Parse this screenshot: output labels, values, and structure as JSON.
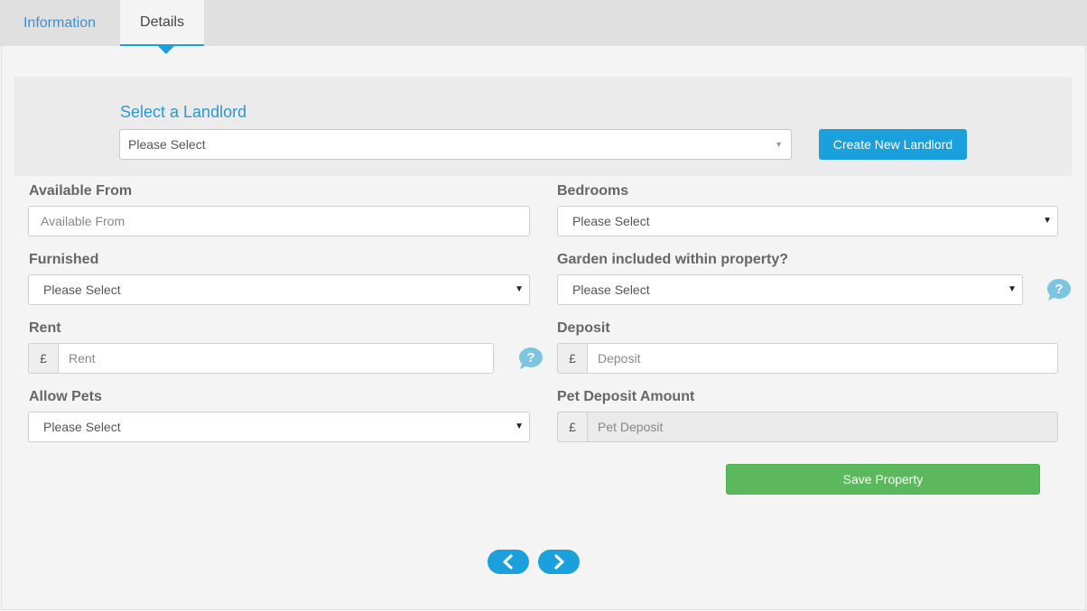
{
  "tabs": [
    {
      "label": "Information",
      "active": false
    },
    {
      "label": "Details",
      "active": true
    }
  ],
  "landlord": {
    "title": "Select a Landlord",
    "select_value": "Please Select",
    "create_button": "Create New Landlord"
  },
  "form": {
    "available_from": {
      "label": "Available From",
      "placeholder": "Available From"
    },
    "bedrooms": {
      "label": "Bedrooms",
      "value": "Please Select"
    },
    "furnished": {
      "label": "Furnished",
      "value": "Please Select"
    },
    "garden": {
      "label": "Garden included within property?",
      "value": "Please Select"
    },
    "rent": {
      "label": "Rent",
      "currency": "£",
      "placeholder": "Rent"
    },
    "deposit": {
      "label": "Deposit",
      "currency": "£",
      "placeholder": "Deposit"
    },
    "allow_pets": {
      "label": "Allow Pets",
      "value": "Please Select"
    },
    "pet_deposit": {
      "label": "Pet Deposit Amount",
      "currency": "£",
      "placeholder": "Pet Deposit",
      "disabled": true
    }
  },
  "save_button": "Save Property",
  "icons": {
    "help": "question-bubble-icon",
    "prev": "chevron-left-icon",
    "next": "chevron-right-icon",
    "select_caret": "caret-down-icon"
  },
  "colors": {
    "accent": "#1aa0dc",
    "save": "#5cb85c",
    "help_icon": "#7cc4e0"
  }
}
